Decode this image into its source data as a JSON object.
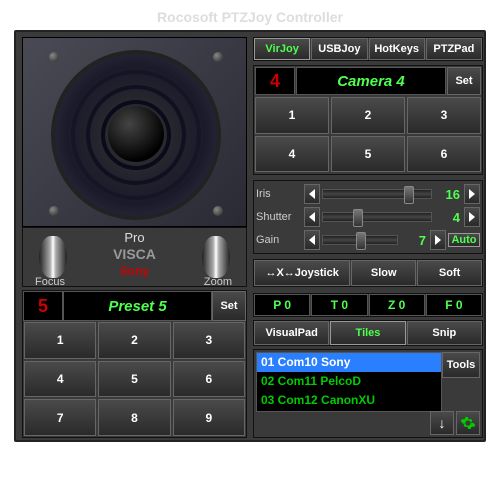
{
  "title": "Rocosoft PTZJoy Controller",
  "under": {
    "pro": "Pro",
    "protocol": "VISCA",
    "brand": "Sony",
    "focus": "Focus",
    "zoom": "Zoom"
  },
  "preset": {
    "num": "5",
    "name": "Preset 5",
    "set": "Set",
    "cells": [
      "1",
      "2",
      "3",
      "4",
      "5",
      "6",
      "7",
      "8",
      "9"
    ]
  },
  "tabs": [
    "VirJoy",
    "USBJoy",
    "HotKeys",
    "PTZPad"
  ],
  "camera": {
    "num": "4",
    "name": "Camera 4",
    "set": "Set",
    "cells": [
      "1",
      "2",
      "3",
      "4",
      "5",
      "6"
    ]
  },
  "isg": {
    "rows": [
      {
        "label": "Iris",
        "value": "16"
      },
      {
        "label": "Shutter",
        "value": "4"
      },
      {
        "label": "Gain",
        "value": "7"
      }
    ],
    "auto": "Auto"
  },
  "jss": {
    "joystick": "↔X↔Joystick",
    "slow": "Slow",
    "soft": "Soft"
  },
  "ptzf": [
    "P 0",
    "T 0",
    "Z 0",
    "F 0"
  ],
  "vts": [
    "VisualPad",
    "Tiles",
    "Snip"
  ],
  "com": {
    "rows": [
      "01 Com10 Sony",
      "02 Com11 PelcoD",
      "03 Com12 CanonXU"
    ],
    "tools": "Tools"
  }
}
